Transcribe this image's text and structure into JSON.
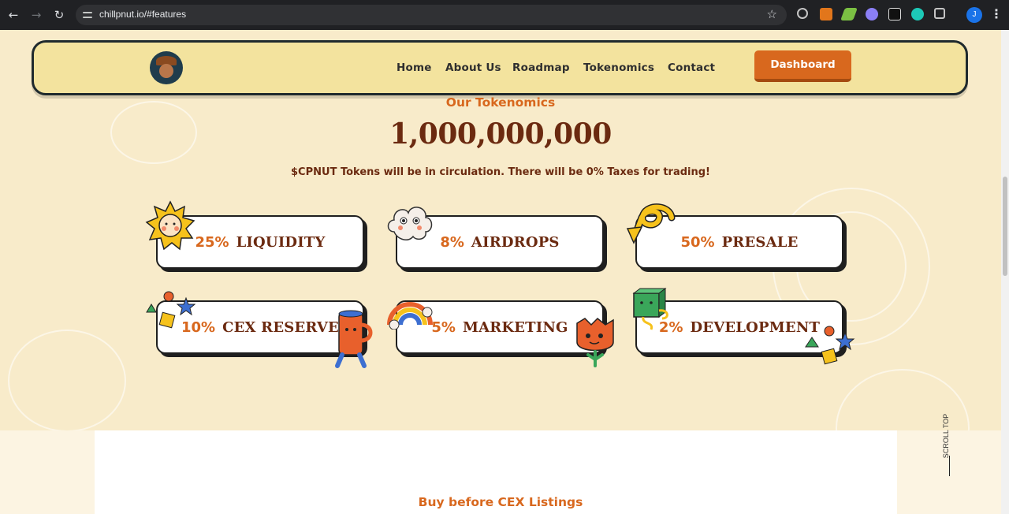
{
  "browser": {
    "url": "chillpnut.io/#features",
    "profile_initial": "J",
    "icons": [
      "back-icon",
      "forward-icon",
      "reload-icon",
      "site-settings-icon",
      "bookmark-star-icon",
      "extensions-icon",
      "menu-icon"
    ]
  },
  "nav": {
    "links": [
      "Home",
      "About Us",
      "Roadmap",
      "Tokenomics",
      "Contact"
    ],
    "dashboard_label": "Dashboard"
  },
  "tokenomics": {
    "subtitle": "Our Tokenomics",
    "supply": "1,000,000,000",
    "description": "$CPNUT Tokens will be in circulation. There will be 0% Taxes for trading!",
    "allocations": [
      {
        "percent": "25%",
        "label": "LIQUIDITY"
      },
      {
        "percent": "8%",
        "label": "AIRDROPS"
      },
      {
        "percent": "50%",
        "label": "PRESALE"
      },
      {
        "percent": "10%",
        "label": "CEX RESERVE"
      },
      {
        "percent": "5%",
        "label": "MARKETING"
      },
      {
        "percent": "2%",
        "label": "DEVELOPMENT"
      }
    ]
  },
  "next_section": {
    "title": "Buy before CEX Listings"
  },
  "scroll_top_label": "SCROLL TOP",
  "colors": {
    "accent_orange": "#d8681e",
    "text_brown": "#6b2a10",
    "nav_yellow": "#f3e39e",
    "page_cream": "#f8ebca"
  }
}
